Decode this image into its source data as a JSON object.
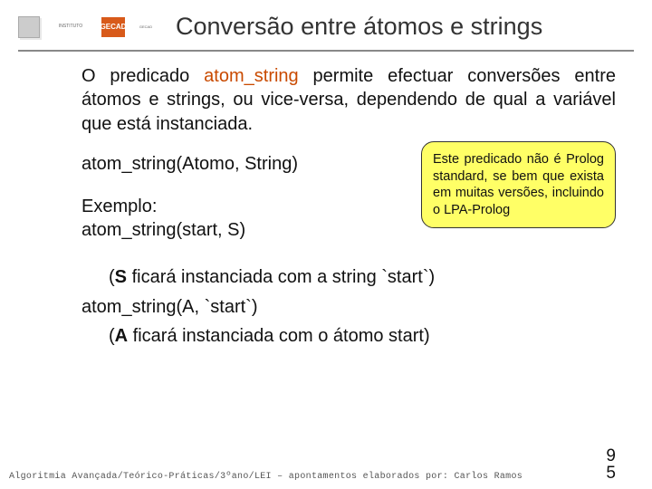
{
  "header": {
    "logo2_text": "GECAD",
    "title": "Conversão entre átomos e strings"
  },
  "body": {
    "para1_pre": "O predicado ",
    "para1_kw": "atom_string",
    "para1_post": " permite efectuar conversões entre átomos e strings, ou vice-versa, dependendo de qual a variável que está instanciada.",
    "sig": "atom_string(Atomo, String)",
    "example_label": "Exemplo:",
    "example1": "atom_string(start, S)",
    "example1_result_pre": "(",
    "example1_result_bold": "S",
    "example1_result_post": " ficará instanciada com a string `start`)",
    "example2": "atom_string(A, `start`)",
    "example2_result_pre": "(",
    "example2_result_bold": "A",
    "example2_result_post": " ficará instanciada com o átomo start)",
    "note": "Este predicado não é Prolog standard, se bem que exista em muitas versões, incluindo o LPA-Prolog"
  },
  "footer": {
    "text": "Algoritmia Avançada/Teórico-Práticas/3ºano/LEI – apontamentos elaborados por: Carlos Ramos",
    "page_top": "9",
    "page_bottom": "5"
  }
}
